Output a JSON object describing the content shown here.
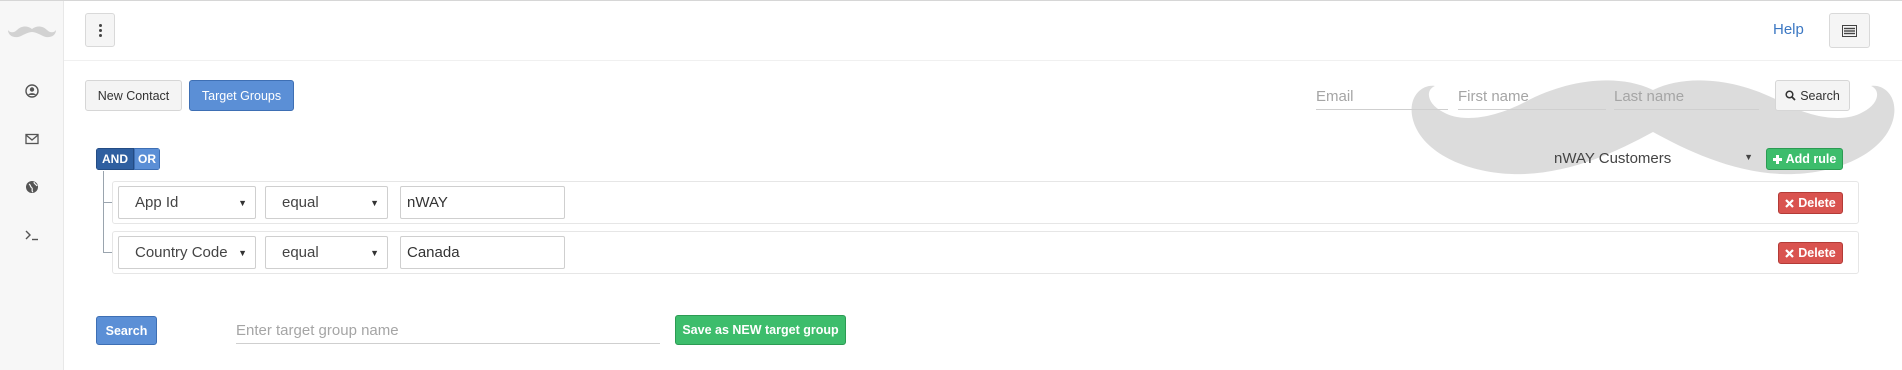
{
  "sidebar": {
    "logo_icon": "mustache-logo-icon",
    "items": [
      {
        "icon": "user-circle-icon"
      },
      {
        "icon": "envelope-icon"
      },
      {
        "icon": "globe-icon"
      },
      {
        "icon": "terminal-icon"
      }
    ]
  },
  "header": {
    "menu_icon": "kebab-menu-icon",
    "help_label": "Help",
    "layout_icon": "list-layout-icon"
  },
  "toolbar": {
    "new_contact_label": "New Contact",
    "target_groups_label": "Target Groups"
  },
  "quick_search": {
    "email_placeholder": "Email",
    "first_name_placeholder": "First name",
    "last_name_placeholder": "Last name",
    "search_label": "Search",
    "search_icon": "search-icon"
  },
  "query_builder": {
    "and_label": "AND",
    "or_label": "OR",
    "active_condition": "AND",
    "target_group_selected": "nWAY Customers",
    "add_rule_label": "Add rule",
    "add_rule_icon": "plus-icon",
    "rules": [
      {
        "field": "App Id",
        "operator": "equal",
        "value": "nWAY",
        "delete_label": "Delete",
        "delete_icon": "close-icon"
      },
      {
        "field": "Country Code",
        "operator": "equal",
        "value": "Canada",
        "delete_label": "Delete",
        "delete_icon": "close-icon"
      }
    ]
  },
  "footer": {
    "search_label": "Search",
    "target_group_name_placeholder": "Enter target group name",
    "save_label": "Save as NEW target group"
  },
  "colors": {
    "primary": "#5b8fd6",
    "primary_dark": "#2f5fa0",
    "success": "#3dbd6c",
    "danger": "#d9534f",
    "link": "#3c78c3"
  }
}
